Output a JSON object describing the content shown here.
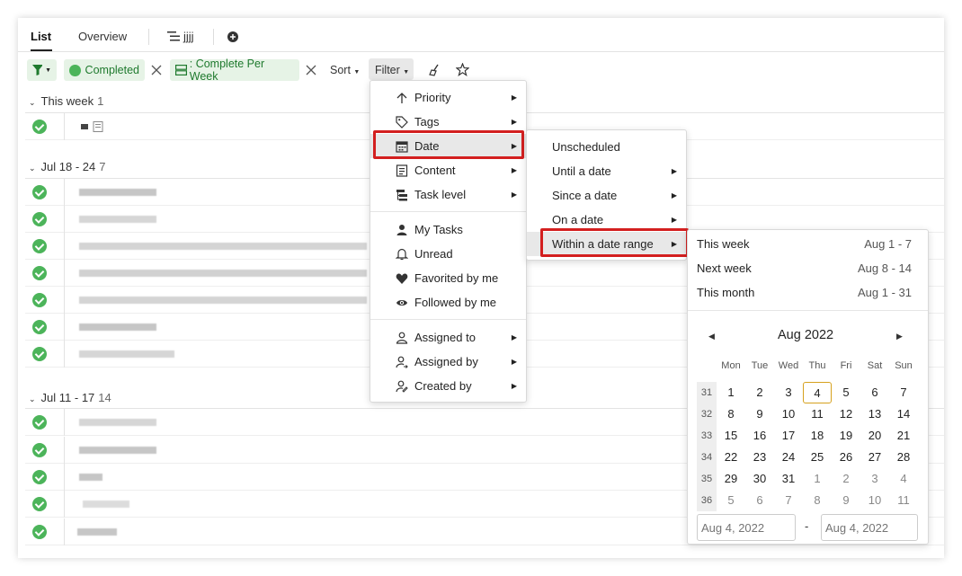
{
  "tabs": {
    "list": "List",
    "overview": "Overview",
    "view": "jjjj"
  },
  "toolbar": {
    "completed_chip": "Completed",
    "group_chip": ": Complete Per Week",
    "sort_label": "Sort",
    "filter_label": "Filter"
  },
  "groups": [
    {
      "label": "This week",
      "count": "1"
    },
    {
      "label": "Jul 18 - 24",
      "count": "7"
    },
    {
      "label": "Jul 11 - 17",
      "count": "14"
    }
  ],
  "filter_menu": {
    "items": [
      {
        "label": "Priority",
        "icon": "arrow-up-icon"
      },
      {
        "label": "Tags",
        "icon": "tag-icon"
      },
      {
        "label": "Date",
        "icon": "calendar-icon"
      },
      {
        "label": "Content",
        "icon": "document-icon"
      },
      {
        "label": "Task level",
        "icon": "hierarchy-icon"
      },
      {
        "label": "My Tasks",
        "icon": "person-icon"
      },
      {
        "label": "Unread",
        "icon": "bell-icon"
      },
      {
        "label": "Favorited by me",
        "icon": "heart-icon"
      },
      {
        "label": "Followed by me",
        "icon": "eye-icon"
      },
      {
        "label": "Assigned to",
        "icon": "user-icon"
      },
      {
        "label": "Assigned by",
        "icon": "user-arrow-icon"
      },
      {
        "label": "Created by",
        "icon": "user-edit-icon"
      }
    ]
  },
  "date_menu": {
    "items": [
      "Unscheduled",
      "Until a date",
      "Since a date",
      "On a date",
      "Within a date range"
    ]
  },
  "range_menu": {
    "presets": [
      {
        "label": "This week",
        "dates": "Aug 1 - 7"
      },
      {
        "label": "Next week",
        "dates": "Aug 8 - 14"
      },
      {
        "label": "This month",
        "dates": "Aug 1 - 31"
      }
    ],
    "calendar": {
      "title": "Aug 2022",
      "weekdays": [
        "Mon",
        "Tue",
        "Wed",
        "Thu",
        "Fri",
        "Sat",
        "Sun"
      ],
      "weeks": [
        {
          "num": "31",
          "days": [
            "1",
            "2",
            "3",
            "4",
            "5",
            "6",
            "7"
          ]
        },
        {
          "num": "32",
          "days": [
            "8",
            "9",
            "10",
            "11",
            "12",
            "13",
            "14"
          ]
        },
        {
          "num": "33",
          "days": [
            "15",
            "16",
            "17",
            "18",
            "19",
            "20",
            "21"
          ]
        },
        {
          "num": "34",
          "days": [
            "22",
            "23",
            "24",
            "25",
            "26",
            "27",
            "28"
          ]
        },
        {
          "num": "35",
          "days": [
            "29",
            "30",
            "31",
            "1",
            "2",
            "3",
            "4"
          ]
        },
        {
          "num": "36",
          "days": [
            "5",
            "6",
            "7",
            "8",
            "9",
            "10",
            "11"
          ]
        }
      ],
      "today": "4"
    },
    "start_placeholder": "Aug 4, 2022",
    "end_placeholder": "Aug 4, 2022",
    "separator": "-"
  },
  "colors": {
    "accent_green": "#4cb45a",
    "highlight_red": "#d31f1f",
    "today_border": "#d6a11e"
  }
}
